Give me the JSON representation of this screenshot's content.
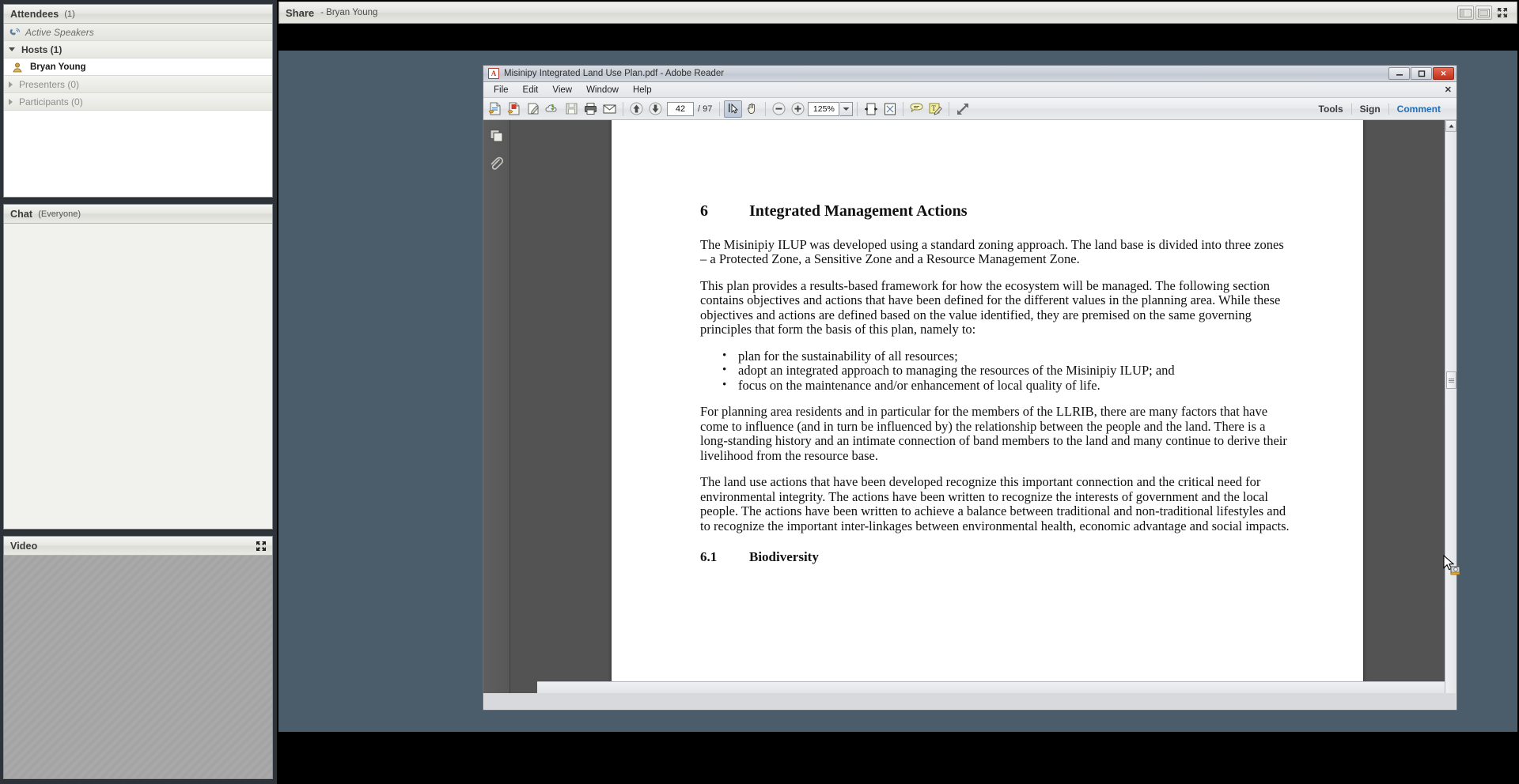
{
  "connect": {
    "attendees_pod": {
      "title": "Attendees",
      "count": "(1)",
      "active_speakers_label": "Active Speakers",
      "groups": [
        {
          "label": "Hosts (1)",
          "expanded": true,
          "members": [
            "Bryan Young"
          ]
        },
        {
          "label": "Presenters (0)",
          "expanded": false,
          "members": []
        },
        {
          "label": "Participants (0)",
          "expanded": false,
          "members": []
        }
      ]
    },
    "chat_pod": {
      "title": "Chat",
      "scope": "(Everyone)",
      "messages": []
    },
    "video_pod": {
      "title": "Video",
      "expand_icon": "fullscreen-icon"
    },
    "share_bar": {
      "title": "Share",
      "owner": "- Bryan Young",
      "buttons": [
        "layout-icon",
        "window-icon",
        "fullscreen-icon"
      ]
    }
  },
  "reader": {
    "window_title": "Misinipy Integrated Land Use Plan.pdf - Adobe Reader",
    "app_icon": "adobe-reader-icon",
    "window_controls": {
      "minimize": "—",
      "maximize": "□",
      "close": "✕"
    },
    "menu": [
      "File",
      "Edit",
      "View",
      "Window",
      "Help"
    ],
    "menubar_close": "✕",
    "toolbar": {
      "left_icons": [
        "open-file-icon",
        "create-pdf-icon",
        "edit-pdf-icon",
        "upload-cloud-icon",
        "save-icon",
        "print-icon",
        "email-icon"
      ],
      "previous_page_icon": "arrow-up-icon",
      "next_page_icon": "arrow-down-icon",
      "page_number": "42",
      "page_total": "/ 97",
      "select_tool_icon": "select-cursor-icon",
      "hand_tool_icon": "hand-icon",
      "zoom_out_icon": "zoom-out-icon",
      "zoom_in_icon": "zoom-in-icon",
      "zoom_level": "125%",
      "zoom_dropdown_icon": "chevron-down-icon",
      "fit_width_icon": "fit-width-icon",
      "fit_page_icon": "fit-page-icon",
      "sticky_note_icon": "comment-balloon-icon",
      "highlight_icon": "highlight-text-icon",
      "expand_icon": "expand-arrows-icon",
      "right_links": [
        {
          "label": "Tools",
          "accent": false
        },
        {
          "label": "Sign",
          "accent": false
        },
        {
          "label": "Comment",
          "accent": true
        }
      ]
    },
    "nav_pane": {
      "thumbnails_icon": "page-thumbnails-icon",
      "attachments_icon": "paperclip-icon"
    },
    "document": {
      "heading_number": "6",
      "heading_text": "Integrated Management Actions",
      "paragraphs": [
        "The Misinipiy ILUP was developed using a standard zoning approach.  The land base is divided into three zones – a Protected Zone, a Sensitive Zone and a Resource Management Zone.",
        "This plan provides a results-based framework for how the ecosystem will be managed.  The following section contains objectives and actions that have been defined for the different values in the planning area.  While these objectives and actions are defined based on the value identified, they are premised on the same governing principles that form the basis of this plan, namely to:"
      ],
      "bullets": [
        "plan for the sustainability of all resources;",
        "adopt an integrated approach to managing the resources of the Misinipiy ILUP; and",
        "focus on the maintenance and/or enhancement of local quality of life."
      ],
      "paragraphs_after": [
        "For planning area residents and in particular for the members of the LLRIB, there are many factors that have come to influence (and in turn be influenced by) the relationship between the people and the land.  There is a long-standing history and an intimate connection of band members to the land and many continue to derive their livelihood from the resource base.",
        "The land use actions that have been developed recognize this important connection and the critical need for environmental integrity.  The actions have been written to recognize the interests of government and the local people.  The actions have been written to achieve a balance between traditional and non-traditional lifestyles and to recognize the important inter-linkages between environmental health, economic advantage and social impacts."
      ],
      "subheading_number": "6.1",
      "subheading_text": "Biodiversity"
    }
  },
  "colors": {
    "accent": "#1f6fb8",
    "stage": "#4b5c6b",
    "pod_bg": "#f2f2f0",
    "close_red": "#c0301a"
  }
}
